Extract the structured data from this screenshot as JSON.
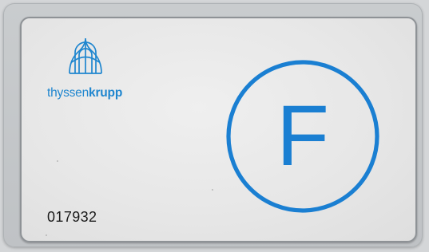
{
  "card": {
    "brand_thin": "thyssen",
    "brand_bold": "krupp",
    "number": "017932",
    "emblem_letter": "F"
  },
  "colors": {
    "brand_blue": "#1f86cf",
    "emblem_blue": "#1a7fd2",
    "number_text": "#1a1a1a",
    "card_face": "#e9e9e9",
    "background": "#d4d6d8"
  },
  "icons": {
    "logo": "thyssenkrupp-arches-logo",
    "emblem": "circled-letter-emblem"
  }
}
